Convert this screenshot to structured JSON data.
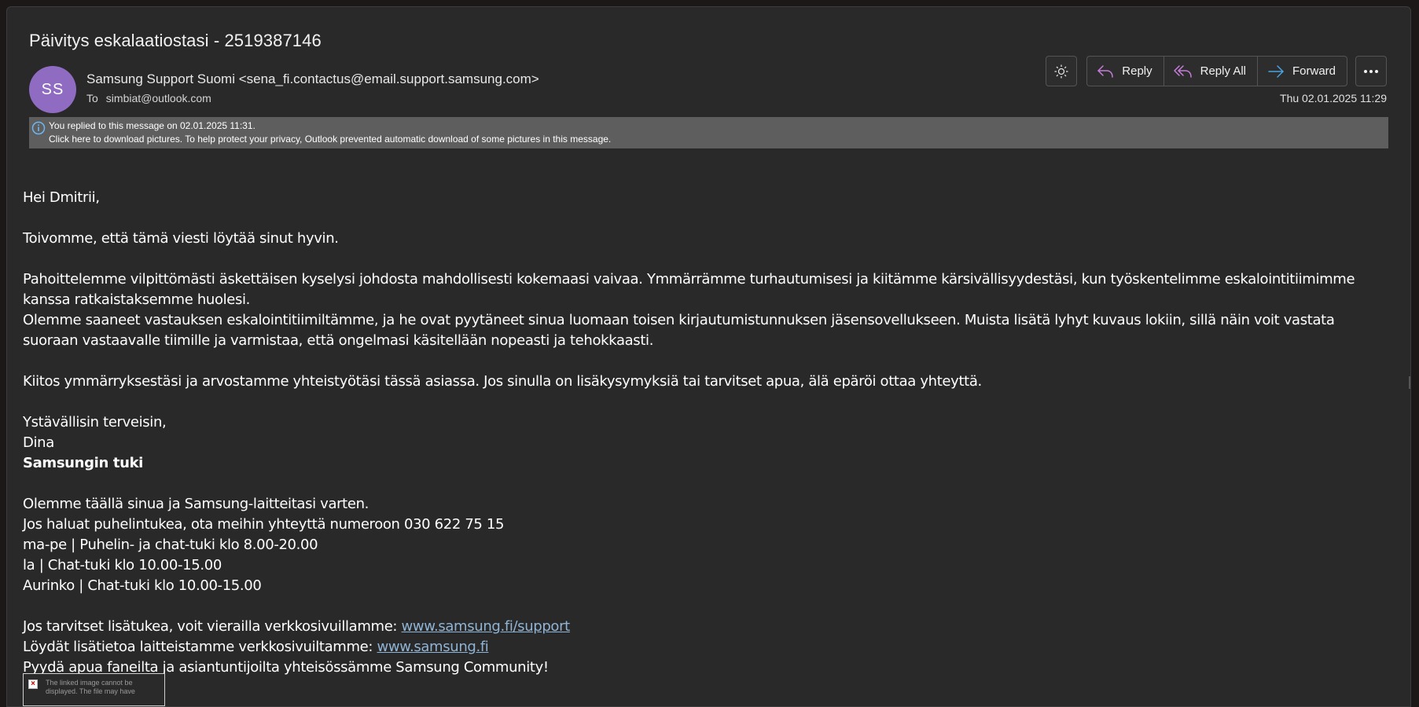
{
  "message": {
    "subject": "Päivitys eskalaatiostasi - 2519387146",
    "avatar_initials": "SS",
    "sender": "Samsung Support Suomi <sena_fi.contactus@email.support.samsung.com>",
    "to_label": "To",
    "to_address": "simbiat@outlook.com",
    "date": "Thu 02.01.2025 11:29"
  },
  "toolbar": {
    "brightness_icon": "sun-icon",
    "reply_label": "Reply",
    "reply_all_label": "Reply All",
    "forward_label": "Forward",
    "more_icon": "more-dots-icon"
  },
  "info_bar": {
    "icon": "info-icon",
    "line1": "You replied to this message on 02.01.2025 11:31.",
    "line2": "Click here to download pictures. To help protect your privacy, Outlook prevented automatic download of some pictures in this message."
  },
  "body": {
    "greeting": "Hei Dmitrii,",
    "p1": "Toivomme, että tämä viesti löytää sinut hyvin.",
    "p2a": "Pahoittelemme vilpittömästi äskettäisen kyselysi johdosta mahdollisesti kokemaasi vaivaa. Ymmärrämme turhautumisesi ja kiitämme kärsivällisyydestäsi, kun työskentelimme eskalointitiimimme kanssa ratkaistaksemme huolesi.",
    "p2b": "Olemme saaneet vastauksen eskalointitiimiltämme, ja he ovat pyytäneet sinua luomaan toisen kirjautumistunnuksen jäsensovellukseen. Muista lisätä lyhyt kuvaus lokiin, sillä näin voit vastata suoraan vastaavalle tiimille ja varmistaa, että ongelmasi käsitellään nopeasti ja tehokkaasti.",
    "p3": "Kiitos ymmärryksestäsi ja arvostamme yhteistyötäsi tässä asiassa. Jos sinulla on lisäkysymyksiä tai tarvitset apua, älä epäröi ottaa yhteyttä.",
    "closing": "Ystävällisin terveisin,",
    "signer": "Dina",
    "team": "Samsungin tuki",
    "support1": "Olemme täällä sinua ja Samsung-laitteitasi varten.",
    "support2": "Jos haluat puhelintukea, ota meihin yhteyttä numeroon 030 622 75 15",
    "support3": "ma-pe | Puhelin- ja chat-tuki klo 8.00-20.00",
    "support4": "la | Chat-tuki klo 10.00-15.00",
    "support5": "Aurinko | Chat-tuki klo 10.00-15.00",
    "link_line1_prefix": "Jos tarvitset lisätukea, voit vierailla verkkosivuillamme: ",
    "link1": "www.samsung.fi/support",
    "link_line2_prefix": "Löydät lisätietoa laitteistamme verkkosivuiltamme: ",
    "link2": "www.samsung.fi",
    "community": "Pyydä apua faneilta ja asiantuntijoilta yhteisössämme Samsung Community!"
  },
  "broken_image": {
    "icon": "broken-image-icon",
    "alt_text": "The linked image cannot be displayed.  The file may have"
  },
  "colors": {
    "background": "#292929",
    "avatar": "#8f6bc2",
    "info_bar": "#5e5e5e",
    "link": "#8fb4d6",
    "reply_icon": "#c77dd9",
    "forward_icon": "#4aa3e0"
  }
}
